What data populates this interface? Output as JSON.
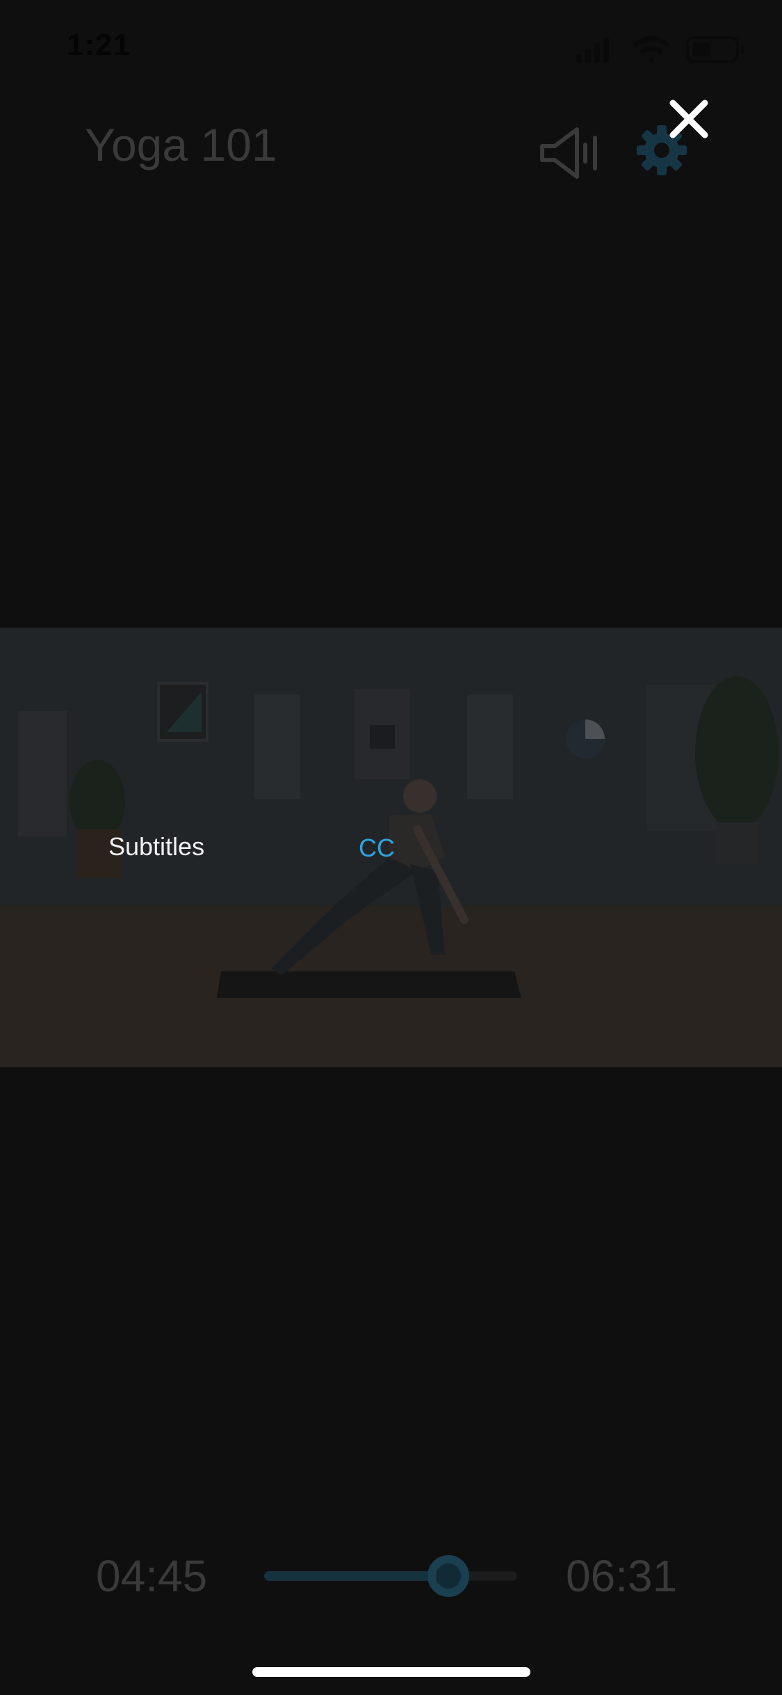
{
  "status_bar": {
    "time": "1:21",
    "icons": [
      "cellular-signal-icon",
      "wifi-icon",
      "battery-icon"
    ]
  },
  "header": {
    "title": "Yoga 101",
    "icons": [
      "speaker-icon",
      "gear-icon",
      "close-icon"
    ]
  },
  "subtitles": {
    "label": "Subtitles",
    "selected_option": "CC"
  },
  "playback": {
    "elapsed": "04:45",
    "total": "06:31",
    "progress_fraction": 0.729
  },
  "colors": {
    "background": "#0f0f0f",
    "accent": "#2ea6dc",
    "dim_text": "#3a3a3a"
  }
}
